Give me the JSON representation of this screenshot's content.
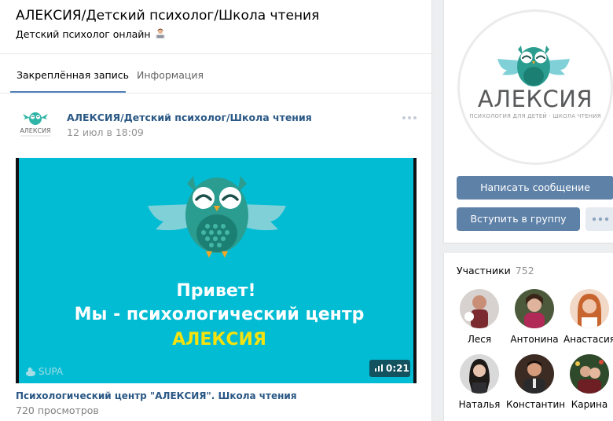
{
  "group": {
    "title": "АЛЕКСИЯ/Детский психолог/Школа чтения",
    "status": "Детский психолог онлайн"
  },
  "tabs": [
    {
      "label": "Закреплённая запись",
      "active": true
    },
    {
      "label": "Информация",
      "active": false
    }
  ],
  "post": {
    "author": "АЛЕКСИЯ/Детский психолог/Школа чтения",
    "date": "12 июл в 18:09",
    "avatar_text": "АЛЕКСИЯ",
    "video": {
      "line1": "Привет!",
      "line2": "Мы - психологический центр",
      "line3": "АЛЕКСИЯ",
      "watermark": "SUPA",
      "duration": "0:21",
      "title": "Психологический центр \"АЛЕКСИЯ\". Школа чтения",
      "views": "720 просмотров"
    }
  },
  "sidebar": {
    "logo_name": "АЛЕКСИЯ",
    "logo_tagline": "ПСИХОЛОГИЯ ДЛЯ ДЕТЕЙ · ШКОЛА ЧТЕНИЯ",
    "message_button": "Написать сообщение",
    "join_button": "Вступить в группу",
    "members_label": "Участники",
    "members_count": "752",
    "members": [
      {
        "name": "Леся"
      },
      {
        "name": "Антонина"
      },
      {
        "name": "Анастасия"
      },
      {
        "name": "Наталья"
      },
      {
        "name": "Константин"
      },
      {
        "name": "Карина"
      }
    ]
  },
  "colors": {
    "link": "#2a5885",
    "accent": "#5181b8",
    "button": "#5e81a8",
    "video_bg": "#02bcd3",
    "owl_teal": "#2fb5a7",
    "highlight_yellow": "#f4e20f"
  }
}
